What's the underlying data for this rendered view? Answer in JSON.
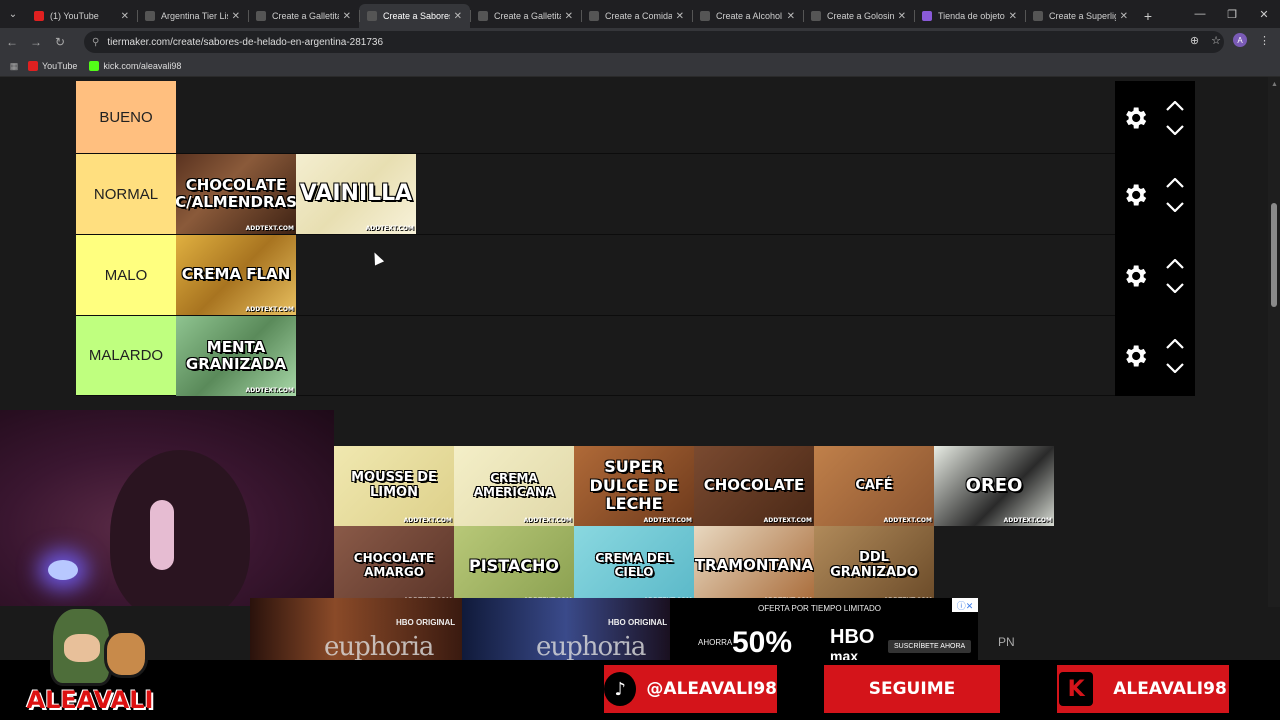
{
  "browser": {
    "tabs": [
      {
        "title": "(1) YouTube",
        "color": "#e02020",
        "active": false
      },
      {
        "title": "Argentina Tier Lis",
        "color": "#555555",
        "active": false
      },
      {
        "title": "Create a Galletita",
        "color": "#555555",
        "active": false
      },
      {
        "title": "Create a Sabores",
        "color": "#555555",
        "active": true
      },
      {
        "title": "Create a Galletita",
        "color": "#555555",
        "active": false
      },
      {
        "title": "Create a Comida",
        "color": "#555555",
        "active": false
      },
      {
        "title": "Create a Alcohol",
        "color": "#555555",
        "active": false
      },
      {
        "title": "Create a Golosina",
        "color": "#555555",
        "active": false
      },
      {
        "title": "Tienda de objeto",
        "color": "#8a5ad8",
        "active": false
      },
      {
        "title": "Create a Superlig",
        "color": "#555555",
        "active": false
      }
    ],
    "url": "tiermaker.com/create/sabores-de-helado-en-argentina-281736",
    "avatar_letter": "A",
    "bookmarks": [
      {
        "label": "YouTube",
        "color": "#e02020"
      },
      {
        "label": "kick.com/aleavali98",
        "color": "#53fc18"
      }
    ]
  },
  "tiers": [
    {
      "label": "BUENO",
      "color": "#ffbf7f",
      "items": []
    },
    {
      "label": "NORMAL",
      "color": "#ffdf7f",
      "items": [
        {
          "text": "CHOCOLATE C/ALMENDRAS",
          "bg": "linear-gradient(135deg,#5a3320,#8a5a3a 40%,#3e2214)",
          "size": "15px"
        },
        {
          "text": "VAINILLA",
          "bg": "linear-gradient(135deg,#f4eed0,#e8dfb2 50%,#f8f2da)",
          "size": "22px"
        }
      ]
    },
    {
      "label": "MALO",
      "color": "#ffff7f",
      "items": [
        {
          "text": "CREMA FLAN",
          "bg": "linear-gradient(135deg,#e0b040,#a87420 50%,#e8c060)",
          "size": "15px"
        }
      ]
    },
    {
      "label": "MALARDO",
      "color": "#bfff7f",
      "items": [
        {
          "text": "MENTA GRANIZADA",
          "bg": "linear-gradient(135deg,#8fc490,#5a8a5a 50%,#a8d8a8)",
          "size": "15px"
        }
      ]
    }
  ],
  "pool": [
    {
      "text": "MOUSSE DE LIMON",
      "bg": "linear-gradient(135deg,#f0e8b0,#ddd08a)",
      "size": "13px"
    },
    {
      "text": "CREMA AMERICANA",
      "bg": "linear-gradient(135deg,#f4efc8,#e0d8a8)",
      "size": "12px"
    },
    {
      "text": "SUPER DULCE DE LECHE",
      "bg": "linear-gradient(135deg,#b06a38,#6e3a1c)",
      "size": "16px"
    },
    {
      "text": "CHOCOLATE",
      "bg": "linear-gradient(135deg,#7a4a30,#4a2816)",
      "size": "15px"
    },
    {
      "text": "CAFÉ",
      "bg": "linear-gradient(135deg,#c0804a,#8a5430)",
      "size": "13px"
    },
    {
      "text": "OREO",
      "bg": "linear-gradient(135deg,#e8ece4,#2a2a2a 60%,#d8dcd4)",
      "size": "18px"
    },
    {
      "text": "CHOCOLATE AMARGO",
      "bg": "linear-gradient(135deg,#8a5a48,#5a3428)",
      "size": "12px"
    },
    {
      "text": "PISTACHO",
      "bg": "linear-gradient(135deg,#b8c878,#8aa050)",
      "size": "16px"
    },
    {
      "text": "CREMA DEL CIELO",
      "bg": "linear-gradient(135deg,#8ad8e0,#5ab8c8)",
      "size": "12px"
    },
    {
      "text": "TRAMONTANA",
      "bg": "linear-gradient(135deg,#e8d8c0,#a86a38)",
      "size": "15px"
    },
    {
      "text": "DDL GRANIZADO",
      "bg": "linear-gradient(135deg,#b08a5a,#6a4a28)",
      "size": "13px"
    }
  ],
  "watermark": "ADDTEXT.COM",
  "ads": {
    "hbo_original": "HBO ORIGINAL",
    "euphoria": "euphoria",
    "offer": "OFERTA POR TIEMPO LIMITADO",
    "ahorra": "AHORRA",
    "percent": "50%",
    "hbo": "HBO",
    "max": "max",
    "subscribe": "SUSCRÍBETE AHORA",
    "pn": "PN"
  },
  "overlay": {
    "brand": "ALEAVALI",
    "tiktok": "@ALEAVALI98",
    "follow": "SEGUIME",
    "kick": "ALEAVALI98"
  }
}
